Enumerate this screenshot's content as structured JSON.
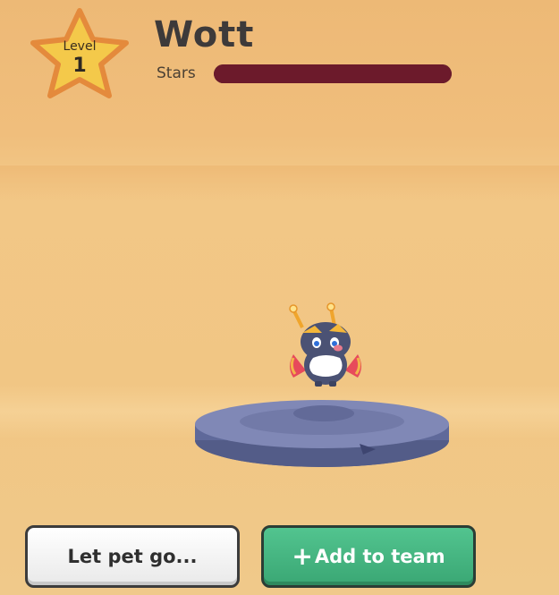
{
  "level": {
    "label": "Level",
    "value": "1"
  },
  "pet": {
    "name": "Wott",
    "sprite_icon": "wott-pet-icon"
  },
  "stars": {
    "label": "Stars",
    "progress_fraction": 1.0
  },
  "buttons": {
    "release_label": "Let pet go...",
    "add_icon": "+",
    "add_label": "Add to team"
  },
  "colors": {
    "stars_bar": "#6c1a2b",
    "star_badge": "#f4c94a",
    "star_badge_border": "#e48a3c",
    "add_button": "#45b582",
    "release_button": "#f4f4f4"
  }
}
